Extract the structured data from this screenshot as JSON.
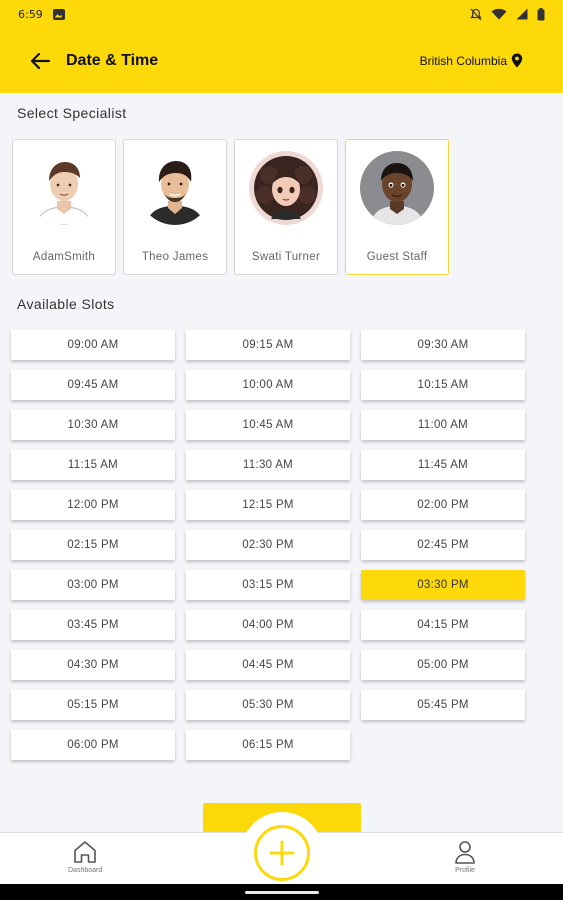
{
  "status_bar": {
    "time": "6:59"
  },
  "header": {
    "title": "Date & Time",
    "location": "British Columbia"
  },
  "specialists_section": {
    "title": "Select Specialist",
    "items": [
      {
        "name": "AdamSmith",
        "selected": false
      },
      {
        "name": "Theo James",
        "selected": false
      },
      {
        "name": "Swati Turner",
        "selected": false
      },
      {
        "name": "Guest Staff",
        "selected": true
      }
    ]
  },
  "slots_section": {
    "title": "Available Slots",
    "slots": [
      "09:00 AM",
      "09:15 AM",
      "09:30 AM",
      "09:45 AM",
      "10:00 AM",
      "10:15 AM",
      "10:30 AM",
      "10:45 AM",
      "11:00 AM",
      "11:15 AM",
      "11:30 AM",
      "11:45 AM",
      "12:00 PM",
      "12:15 PM",
      "02:00 PM",
      "02:15 PM",
      "02:30 PM",
      "02:45 PM",
      "03:00 PM",
      "03:15 PM",
      "03:30 PM",
      "03:45 PM",
      "04:00 PM",
      "04:15 PM",
      "04:30 PM",
      "04:45 PM",
      "05:00 PM",
      "05:15 PM",
      "05:30 PM",
      "05:45 PM",
      "06:00 PM",
      "06:15 PM"
    ],
    "selected_slot": "03:30 PM"
  },
  "bottom_nav": {
    "dashboard_label": "Dashboard",
    "profile_label": "Profile",
    "fab_icon": "plus-circle-icon"
  },
  "colors": {
    "accent": "#fdd90a",
    "background": "#f4f5f9"
  }
}
